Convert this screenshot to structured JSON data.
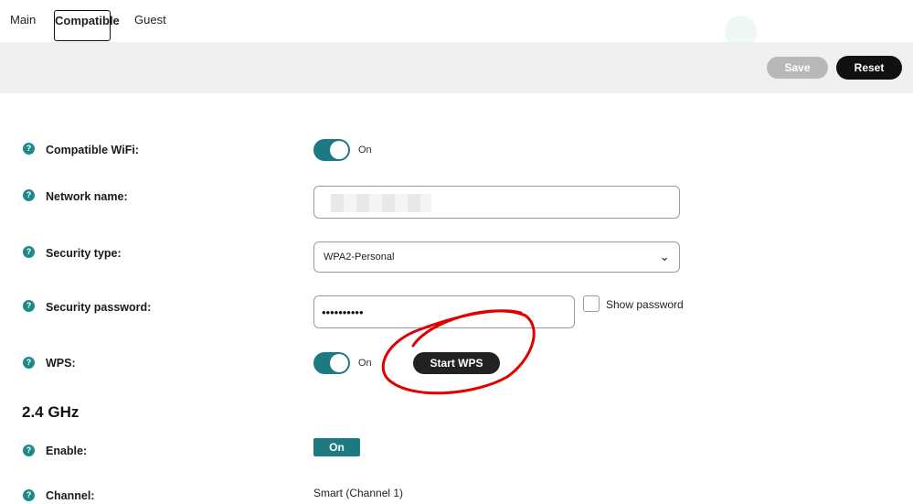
{
  "tabs": {
    "main": "Main",
    "compatible": "Compatible",
    "guest": "Guest"
  },
  "actions": {
    "save": "Save",
    "reset": "Reset"
  },
  "form": {
    "compatible_wifi": {
      "label": "Compatible WiFi:",
      "state": "On"
    },
    "network_name": {
      "label": "Network name:"
    },
    "security_type": {
      "label": "Security type:",
      "value": "WPA2-Personal"
    },
    "security_password": {
      "label": "Security password:",
      "value": "••••••••••",
      "show_password_label": "Show password"
    },
    "wps": {
      "label": "WPS:",
      "state": "On",
      "start_button": "Start WPS"
    }
  },
  "band_24": {
    "title": "2.4 GHz",
    "enable": {
      "label": "Enable:",
      "value": "On"
    },
    "channel": {
      "label": "Channel:",
      "value": "Smart (Channel 1)"
    }
  },
  "icons": {
    "help": "?"
  },
  "colors": {
    "accent": "#1d7a82",
    "annotation": "#e00000"
  }
}
